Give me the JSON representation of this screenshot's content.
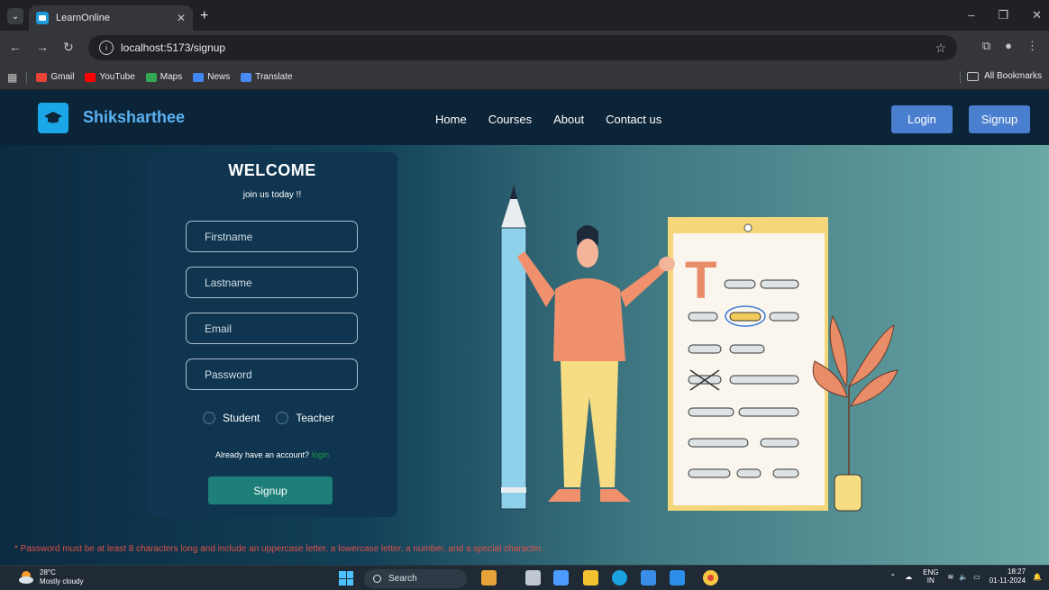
{
  "browser": {
    "tab_title": "LearnOnline",
    "url": "localhost:5173/signup",
    "bookmarks": [
      "Gmail",
      "YouTube",
      "Maps",
      "News",
      "Translate"
    ],
    "all_bookmarks": "All Bookmarks"
  },
  "nav": {
    "brand": "Shiksharthee",
    "links": [
      "Home",
      "Courses",
      "About",
      "Contact us"
    ],
    "login": "Login",
    "signup": "Signup"
  },
  "form": {
    "title": "WELCOME",
    "subtitle": "join us today !!",
    "firstname_placeholder": "Firstname",
    "lastname_placeholder": "Lastname",
    "email_placeholder": "Email",
    "password_placeholder": "Password",
    "role_student": "Student",
    "role_teacher": "Teacher",
    "already_text": "Already have an account?",
    "login_link": "login",
    "submit": "Signup"
  },
  "password_note": "* Password must be at least 8 characters long and include an uppercase letter, a lowercase letter, a number, and a special character.",
  "taskbar": {
    "temperature": "28°C",
    "weather": "Mostly cloudy",
    "search": "Search",
    "lang_1": "ENG",
    "lang_2": "IN",
    "time": "18:27",
    "date": "01-11-2024"
  }
}
